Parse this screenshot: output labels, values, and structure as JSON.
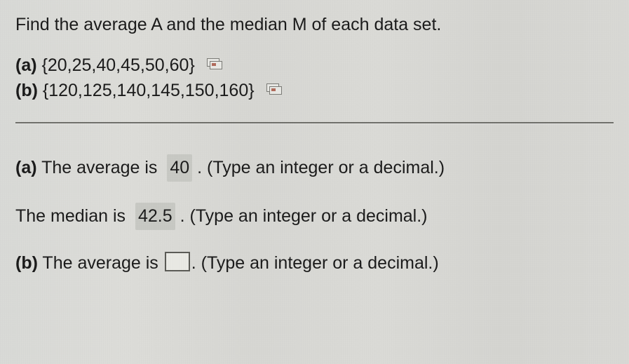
{
  "question": "Find the average A and the median M of each data set.",
  "parts": {
    "a": {
      "label": "(a)",
      "set": "{20,25,40,45,50,60}"
    },
    "b": {
      "label": "(b)",
      "set": "{120,125,140,145,150,160}"
    }
  },
  "answers": {
    "a_avg": {
      "label": "(a)",
      "prefix": "The average is",
      "value": "40",
      "suffix": ". (Type an integer or a decimal.)"
    },
    "a_med": {
      "prefix": "The median is",
      "value": "42.5",
      "suffix": ". (Type an integer or a decimal.)"
    },
    "b_avg": {
      "label": "(b)",
      "prefix": "The average is",
      "suffix": ". (Type an integer or a decimal.)"
    }
  }
}
